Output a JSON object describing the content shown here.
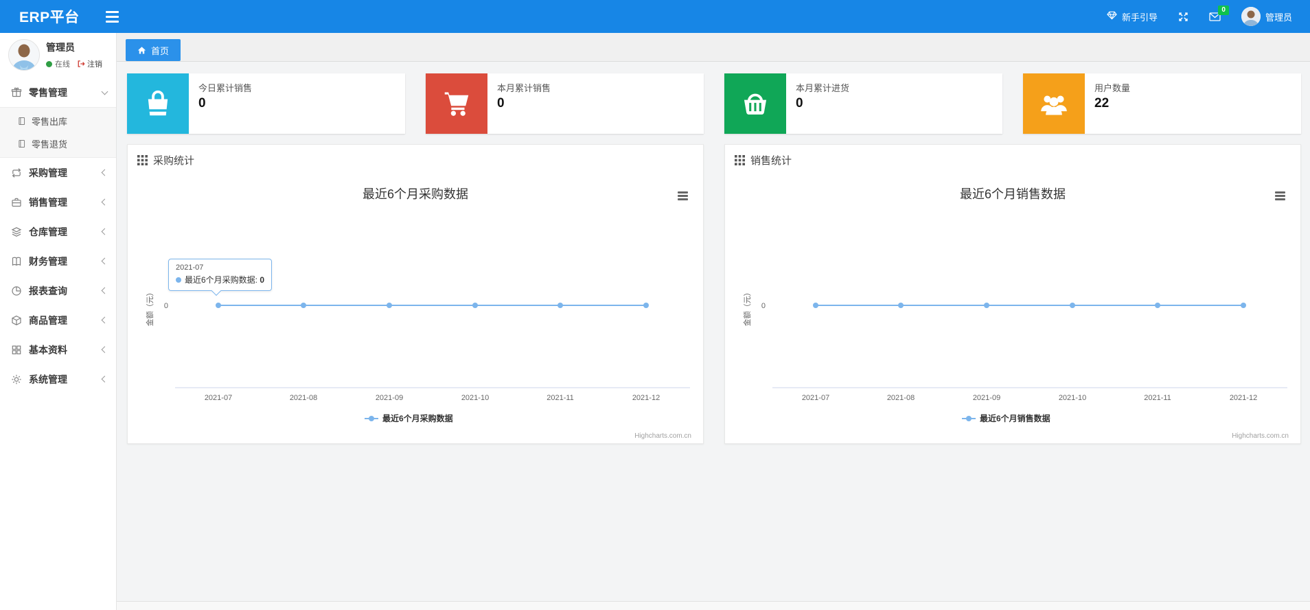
{
  "navbar": {
    "brand": "ERP平台",
    "guide_label": "新手引导",
    "message_badge": "0",
    "user_name": "管理员",
    "color": "#1786e6"
  },
  "tabs": [
    {
      "label": "首页",
      "active": true
    }
  ],
  "sidebar": {
    "user": {
      "name": "管理员",
      "status": "在线",
      "logout_label": "注销"
    },
    "menu": [
      {
        "label": "零售管理",
        "icon": "gift-icon",
        "expanded": true,
        "children": [
          {
            "label": "零售出库",
            "icon": "notebook-icon"
          },
          {
            "label": "零售退货",
            "icon": "notebook-icon"
          }
        ]
      },
      {
        "label": "采购管理",
        "icon": "repeat-icon"
      },
      {
        "label": "销售管理",
        "icon": "briefcase-icon"
      },
      {
        "label": "仓库管理",
        "icon": "layers-icon"
      },
      {
        "label": "财务管理",
        "icon": "ledger-icon"
      },
      {
        "label": "报表查询",
        "icon": "pie-chart-icon"
      },
      {
        "label": "商品管理",
        "icon": "package-icon"
      },
      {
        "label": "基本资料",
        "icon": "grid-icon"
      },
      {
        "label": "系统管理",
        "icon": "gear-icon"
      }
    ]
  },
  "stat_cards": [
    {
      "label": "今日累计销售",
      "value": "0",
      "icon": "shopping-bag-icon",
      "color": "#23b7dd"
    },
    {
      "label": "本月累计销售",
      "value": "0",
      "icon": "shopping-cart-icon",
      "color": "#db4c3c"
    },
    {
      "label": "本月累计进货",
      "value": "0",
      "icon": "shopping-basket-icon",
      "color": "#10a757"
    },
    {
      "label": "用户数量",
      "value": "22",
      "icon": "users-icon",
      "color": "#f5a01a"
    }
  ],
  "panels": [
    {
      "title": "采购统计"
    },
    {
      "title": "销售统计"
    }
  ],
  "chart_data": [
    {
      "type": "line",
      "title": "最近6个月采购数据",
      "categories": [
        "2021-07",
        "2021-08",
        "2021-09",
        "2021-10",
        "2021-11",
        "2021-12"
      ],
      "series": [
        {
          "name": "最近6个月采购数据",
          "values": [
            0,
            0,
            0,
            0,
            0,
            0
          ]
        }
      ],
      "xlabel": "",
      "ylabel": "金额（元）",
      "yticks": [
        "0"
      ],
      "ylim": [
        0,
        1
      ],
      "grid": false,
      "legend_position": "bottom",
      "line_color": "#7cb5ec",
      "credits": "Highcharts.com.cn",
      "tooltip": {
        "header": "2021-07",
        "label": "最近6个月采购数据:",
        "value": "0"
      }
    },
    {
      "type": "line",
      "title": "最近6个月销售数据",
      "categories": [
        "2021-07",
        "2021-08",
        "2021-09",
        "2021-10",
        "2021-11",
        "2021-12"
      ],
      "series": [
        {
          "name": "最近6个月销售数据",
          "values": [
            0,
            0,
            0,
            0,
            0,
            0
          ]
        }
      ],
      "xlabel": "",
      "ylabel": "金额（元）",
      "yticks": [
        "0"
      ],
      "ylim": [
        0,
        1
      ],
      "grid": false,
      "legend_position": "bottom",
      "line_color": "#7cb5ec",
      "credits": "Highcharts.com.cn"
    }
  ]
}
